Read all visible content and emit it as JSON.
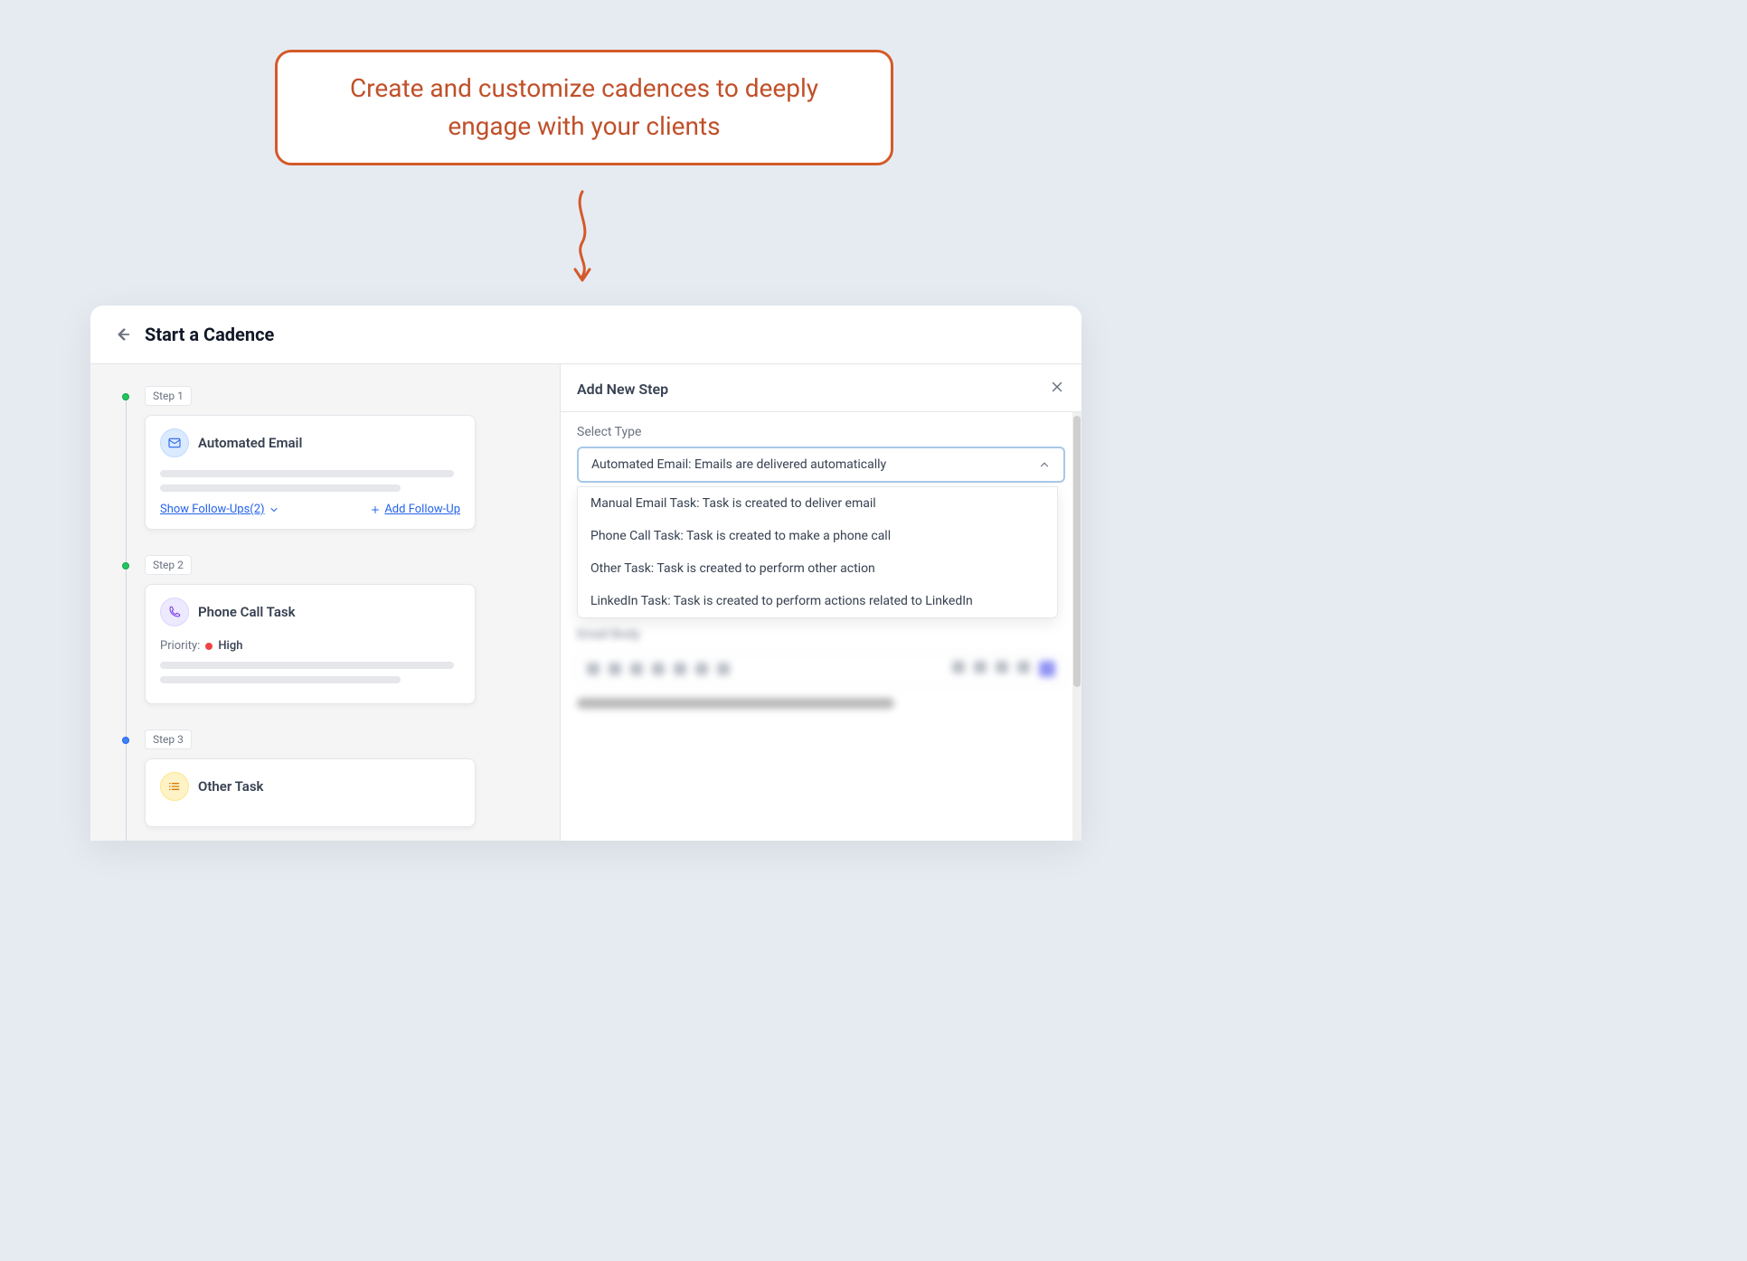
{
  "callout": {
    "text": "Create and customize cadences to deeply engage with your clients"
  },
  "header": {
    "title": "Start a Cadence"
  },
  "steps": [
    {
      "label": "Step 1",
      "title": "Automated Email",
      "dotColor": "green",
      "iconType": "email",
      "footer": {
        "showText": "Show Follow-Ups(2)",
        "addText": "Add Follow-Up"
      }
    },
    {
      "label": "Step 2",
      "title": "Phone Call Task",
      "dotColor": "green",
      "iconType": "phone",
      "priorityLabel": "Priority:",
      "priorityValue": "High"
    },
    {
      "label": "Step 3",
      "title": "Other Task",
      "dotColor": "blue",
      "iconType": "other"
    }
  ],
  "rightPanel": {
    "title": "Add New Step",
    "selectTypeLabel": "Select Type",
    "selectedValue": "Automated Email: Emails are delivered automatically",
    "options": [
      "Manual Email Task: Task is created to deliver email",
      "Phone Call Task: Task is created to make a phone call",
      "Other Task: Task is created to perform other action",
      "LinkedIn Task: Task is created to perform actions related to LinkedIn"
    ],
    "blurred": {
      "sectionLabel": "Email Body",
      "contentLine": "Hello {{FullName}}, You are eligible for a new promotion!"
    }
  }
}
